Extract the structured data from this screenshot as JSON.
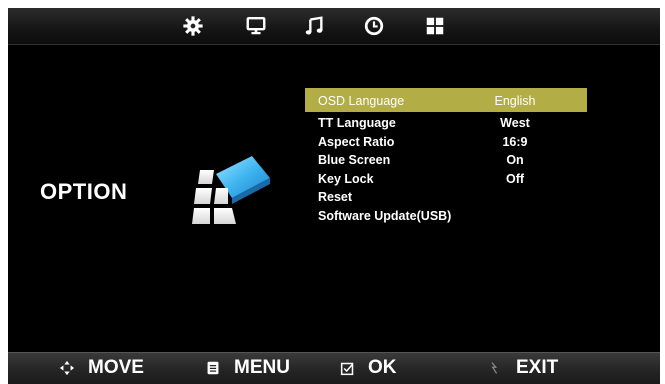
{
  "top_tabs": [
    {
      "icon": "gear-icon"
    },
    {
      "icon": "monitor-icon"
    },
    {
      "icon": "music-note-icon"
    },
    {
      "icon": "clock-icon"
    },
    {
      "icon": "grid-icon"
    }
  ],
  "section": {
    "title": "OPTION",
    "icon": "option-blocks-icon"
  },
  "menu": {
    "items": [
      {
        "label": "OSD Language",
        "value": "English",
        "selected": true
      },
      {
        "label": "TT Language",
        "value": "West"
      },
      {
        "label": "Aspect Ratio",
        "value": "16:9"
      },
      {
        "label": "Blue Screen",
        "value": "On"
      },
      {
        "label": "Key Lock",
        "value": "Off"
      },
      {
        "label": "Reset",
        "value": ""
      },
      {
        "label": "Software Update(USB)",
        "value": ""
      }
    ],
    "highlight_color": "#b3ad45"
  },
  "footer": {
    "move_label": "MOVE",
    "menu_label": "MENU",
    "ok_label": "OK",
    "exit_label": "EXIT"
  }
}
